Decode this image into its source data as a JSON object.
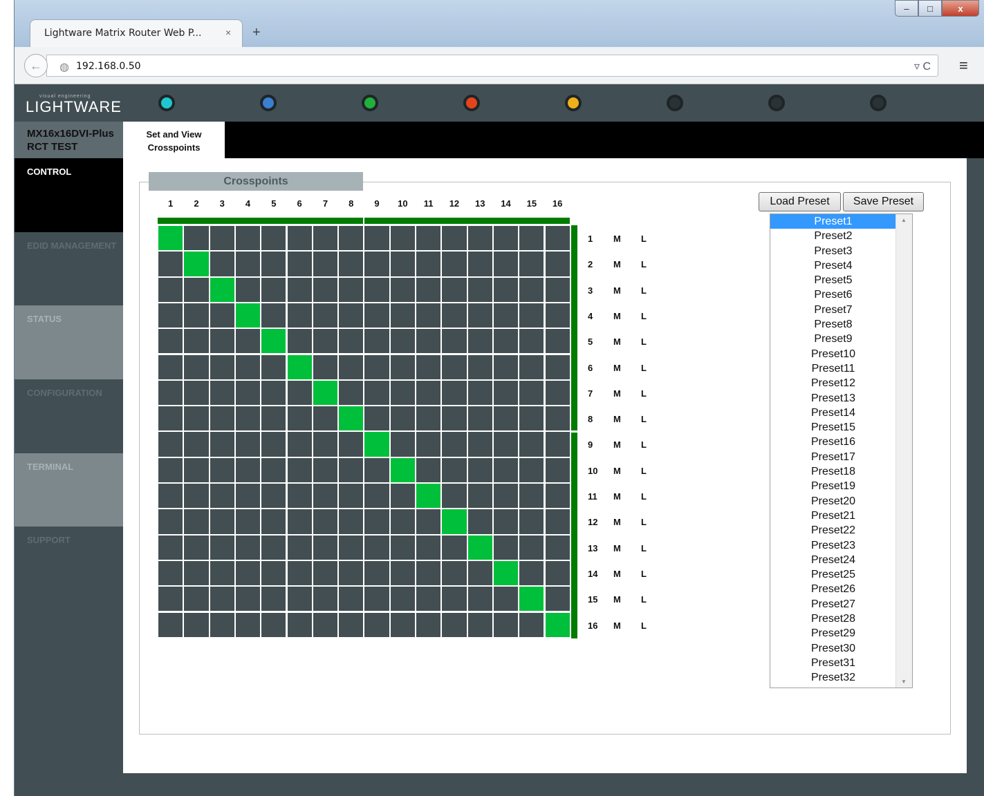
{
  "browser": {
    "tab_title": "Lightware Matrix Router Web P...",
    "tab_close": "×",
    "new_tab": "+",
    "url": "192.168.0.50",
    "win_min": "–",
    "win_max": "□",
    "win_close": "x",
    "back": "←",
    "globe_icon": "globe-icon",
    "reload": "▿ C",
    "menu": "≡"
  },
  "header": {
    "logo_small": "visual engineering",
    "logo_text": "LIGHTWARE",
    "status_leds": [
      "#1ec8d0",
      "#3a7fd0",
      "#1fb13a",
      "#e5431c",
      "#f0b01a",
      "#2a3235",
      "#2a3235",
      "#2a3235"
    ]
  },
  "device": {
    "line1": "MX16x16DVI-Plus",
    "line2": "RCT TEST"
  },
  "sidebar": {
    "items": [
      {
        "label": "CONTROL"
      },
      {
        "label": "EDID MANAGEMENT"
      },
      {
        "label": "STATUS"
      },
      {
        "label": "CONFIGURATION"
      },
      {
        "label": "TERMINAL"
      },
      {
        "label": "SUPPORT"
      }
    ]
  },
  "subtabs": {
    "active_line1": "Set and View",
    "active_line2": "Crosspoints"
  },
  "crosspoints": {
    "title": "Crosspoints",
    "inputs": [
      "1",
      "2",
      "3",
      "4",
      "5",
      "6",
      "7",
      "8",
      "9",
      "10",
      "11",
      "12",
      "13",
      "14",
      "15",
      "16"
    ],
    "outputs": [
      "1",
      "2",
      "3",
      "4",
      "5",
      "6",
      "7",
      "8",
      "9",
      "10",
      "11",
      "12",
      "13",
      "14",
      "15",
      "16"
    ],
    "mute_label": "M",
    "lock_label": "L",
    "connected_input_per_output": [
      1,
      2,
      3,
      4,
      5,
      6,
      7,
      8,
      9,
      10,
      11,
      12,
      13,
      14,
      15,
      16
    ]
  },
  "presets": {
    "load_label": "Load Preset",
    "save_label": "Save Preset",
    "selected": "Preset1",
    "items": [
      "Preset1",
      "Preset2",
      "Preset3",
      "Preset4",
      "Preset5",
      "Preset6",
      "Preset7",
      "Preset8",
      "Preset9",
      "Preset10",
      "Preset11",
      "Preset12",
      "Preset13",
      "Preset14",
      "Preset15",
      "Preset16",
      "Preset17",
      "Preset18",
      "Preset19",
      "Preset20",
      "Preset21",
      "Preset22",
      "Preset23",
      "Preset24",
      "Preset25",
      "Preset26",
      "Preset27",
      "Preset28",
      "Preset29",
      "Preset30",
      "Preset31",
      "Preset32"
    ]
  }
}
